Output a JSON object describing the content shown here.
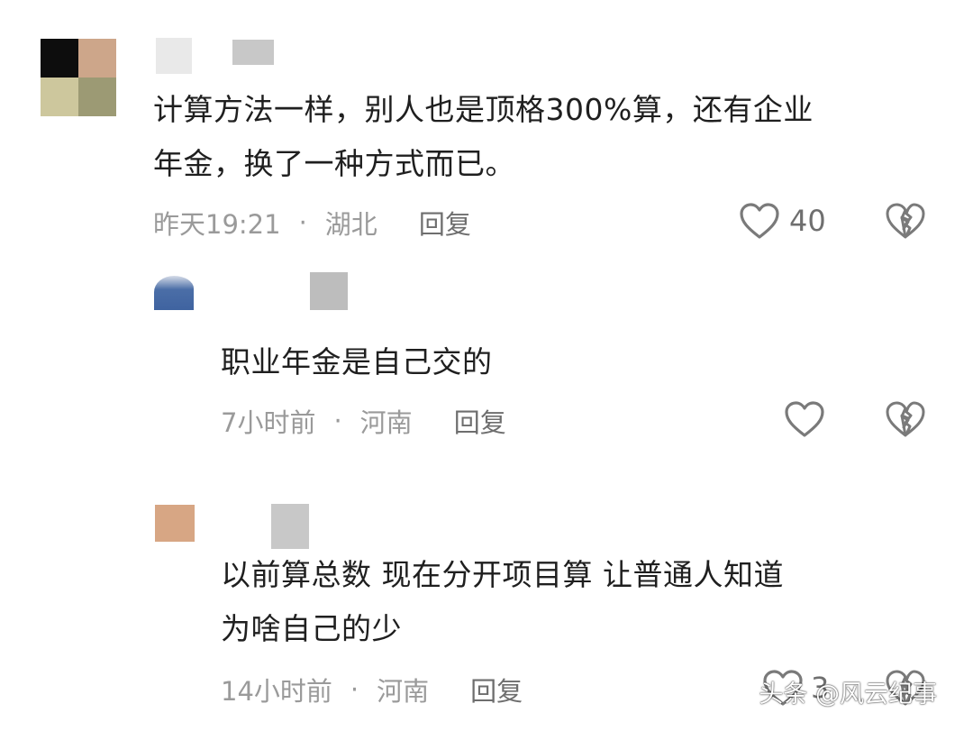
{
  "comments": [
    {
      "text_lines": [
        "计算方法一样，别人也是顶格300%算，还有企业",
        "年金，换了一种方式而已。"
      ],
      "time": "昨天19:21",
      "separator": "·",
      "location": "湖北",
      "reply_label": "回复",
      "likes": "40"
    },
    {
      "text_lines": [
        "职业年金是自己交的"
      ],
      "time": "7小时前",
      "separator": "·",
      "location": "河南",
      "reply_label": "回复"
    },
    {
      "text_lines": [
        "以前算总数 现在分开项目算 让普通人知道",
        "为啥自己的少"
      ],
      "time": "14小时前",
      "separator": "·",
      "location": "河南",
      "reply_label": "回复",
      "likes": "3"
    }
  ],
  "watermark": "头条 @风云纪事",
  "icons": {
    "like": "heart-outline-icon",
    "dislike": "broken-heart-icon"
  },
  "colors": {
    "text": "#1f1f1f",
    "meta": "#9a9a9a",
    "icon": "#7a7a7a"
  }
}
